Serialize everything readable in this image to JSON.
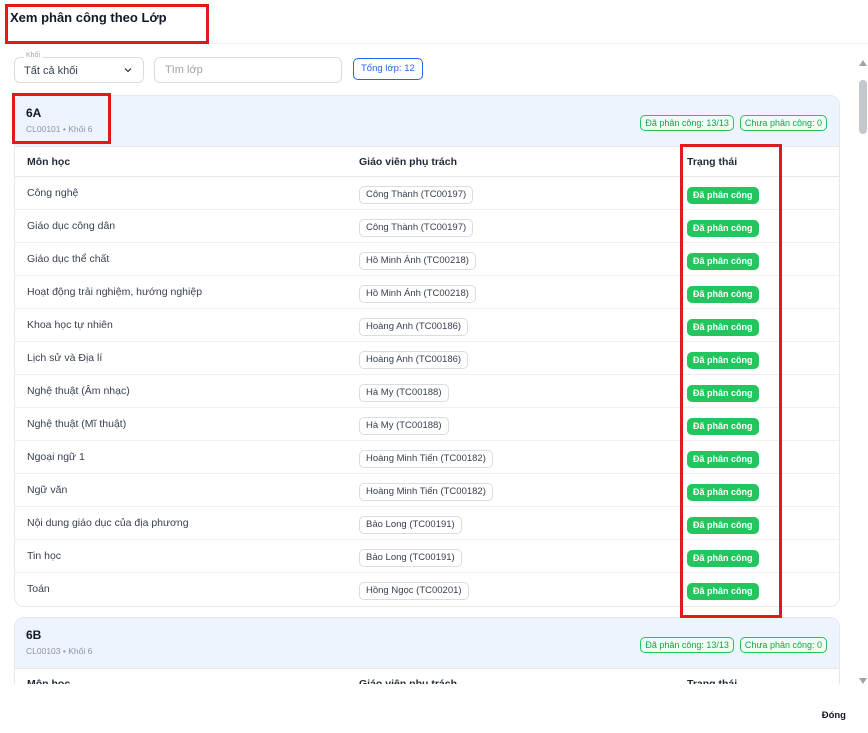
{
  "header": {
    "title": "Xem phân công theo Lớp"
  },
  "filters": {
    "grade_label": "Khối",
    "grade_value": "Tất cả khối",
    "search_placeholder": "Tìm lớp",
    "total_label": "Tổng lớp: 12"
  },
  "table_headers": {
    "subject": "Môn học",
    "teacher": "Giáo viên phụ trách",
    "status": "Trạng thái"
  },
  "classes": [
    {
      "name": "6A",
      "meta": "CL00101 • Khối 6",
      "assigned": "Đã phân công: 13/13",
      "unassigned": "Chưa phân công: 0",
      "rows": [
        {
          "subject": "Công nghệ",
          "teacher": "Công Thành (TC00197)",
          "status": "Đã phân công"
        },
        {
          "subject": "Giáo dục công dân",
          "teacher": "Công Thành (TC00197)",
          "status": "Đã phân công"
        },
        {
          "subject": "Giáo dục thể chất",
          "teacher": "Hồ Minh Ánh (TC00218)",
          "status": "Đã phân công"
        },
        {
          "subject": "Hoạt động trải nghiệm, hướng nghiệp",
          "teacher": "Hồ Minh Ánh (TC00218)",
          "status": "Đã phân công"
        },
        {
          "subject": "Khoa học tự nhiên",
          "teacher": "Hoàng Anh (TC00186)",
          "status": "Đã phân công"
        },
        {
          "subject": "Lịch sử và Địa lí",
          "teacher": "Hoàng Anh (TC00186)",
          "status": "Đã phân công"
        },
        {
          "subject": "Nghệ thuật (Âm nhạc)",
          "teacher": "Hà My (TC00188)",
          "status": "Đã phân công"
        },
        {
          "subject": "Nghệ thuật (Mĩ thuật)",
          "teacher": "Hà My (TC00188)",
          "status": "Đã phân công"
        },
        {
          "subject": "Ngoại ngữ 1",
          "teacher": "Hoàng Minh Tiến (TC00182)",
          "status": "Đã phân công"
        },
        {
          "subject": "Ngữ văn",
          "teacher": "Hoàng Minh Tiến (TC00182)",
          "status": "Đã phân công"
        },
        {
          "subject": "Nội dung giáo dục của địa phương",
          "teacher": "Bảo Long (TC00191)",
          "status": "Đã phân công"
        },
        {
          "subject": "Tin học",
          "teacher": "Bảo Long (TC00191)",
          "status": "Đã phân công"
        },
        {
          "subject": "Toán",
          "teacher": "Hồng Ngọc (TC00201)",
          "status": "Đã phân công"
        }
      ]
    },
    {
      "name": "6B",
      "meta": "CL00103 • Khối 6",
      "assigned": "Đã phân công: 13/13",
      "unassigned": "Chưa phân công: 0",
      "rows": []
    }
  ],
  "footer": {
    "close_label": "Đóng"
  },
  "colors": {
    "accent": "#2563eb",
    "success": "#22c55e",
    "highlight": "#e0191b",
    "card_header_bg": "#eef4fd"
  }
}
